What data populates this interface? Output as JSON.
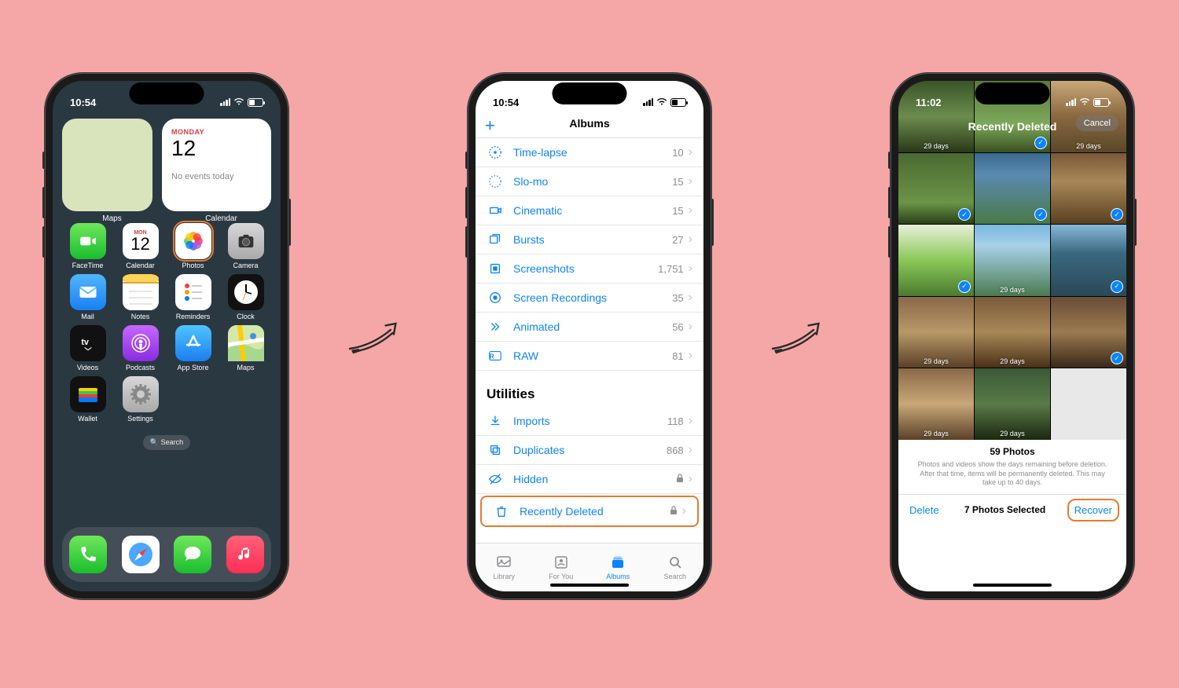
{
  "phone1": {
    "time": "10:54",
    "battery": "48",
    "widgets": {
      "maps_label": "Maps",
      "calendar_label": "Calendar",
      "cal_day": "MONDAY",
      "cal_date": "12",
      "cal_events": "No events today"
    },
    "apps": [
      {
        "label": "FaceTime",
        "icon": "facetime"
      },
      {
        "label": "Calendar",
        "icon": "calendar",
        "sub_top": "MON",
        "sub_main": "12"
      },
      {
        "label": "Photos",
        "icon": "photos",
        "highlight": true
      },
      {
        "label": "Camera",
        "icon": "camera"
      },
      {
        "label": "Mail",
        "icon": "mail"
      },
      {
        "label": "Notes",
        "icon": "notes"
      },
      {
        "label": "Reminders",
        "icon": "reminders"
      },
      {
        "label": "Clock",
        "icon": "clock"
      },
      {
        "label": "Videos",
        "icon": "videos"
      },
      {
        "label": "Podcasts",
        "icon": "podcasts"
      },
      {
        "label": "App Store",
        "icon": "appstore"
      },
      {
        "label": "Maps",
        "icon": "maps"
      },
      {
        "label": "Wallet",
        "icon": "wallet"
      },
      {
        "label": "Settings",
        "icon": "settings"
      }
    ],
    "search": "Search",
    "dock": [
      "phone",
      "safari",
      "messages",
      "music"
    ]
  },
  "phone2": {
    "time": "10:54",
    "battery": "48",
    "header_title": "Albums",
    "media_types": [
      {
        "label": "Time-lapse",
        "count": "10",
        "icon": "timelapse"
      },
      {
        "label": "Slo-mo",
        "count": "15",
        "icon": "slomo"
      },
      {
        "label": "Cinematic",
        "count": "15",
        "icon": "cinematic"
      },
      {
        "label": "Bursts",
        "count": "27",
        "icon": "bursts"
      },
      {
        "label": "Screenshots",
        "count": "1,751",
        "icon": "screenshots"
      },
      {
        "label": "Screen Recordings",
        "count": "35",
        "icon": "screenrec"
      },
      {
        "label": "Animated",
        "count": "56",
        "icon": "animated"
      },
      {
        "label": "RAW",
        "count": "81",
        "icon": "raw"
      }
    ],
    "utilities_header": "Utilities",
    "utilities": [
      {
        "label": "Imports",
        "count": "118",
        "icon": "imports"
      },
      {
        "label": "Duplicates",
        "count": "868",
        "icon": "duplicates"
      },
      {
        "label": "Hidden",
        "lock": true,
        "icon": "hidden"
      },
      {
        "label": "Recently Deleted",
        "lock": true,
        "icon": "trash",
        "highlight": true
      }
    ],
    "tabs": [
      {
        "label": "Library"
      },
      {
        "label": "For You"
      },
      {
        "label": "Albums",
        "active": true
      },
      {
        "label": "Search"
      }
    ]
  },
  "phone3": {
    "time": "11:02",
    "battery": "47",
    "title": "Recently Deleted",
    "cancel": "Cancel",
    "thumbs": [
      {
        "days": "29 days",
        "sel": false,
        "cls": "t1"
      },
      {
        "days": "",
        "sel": true,
        "cls": "t2"
      },
      {
        "days": "29 days",
        "sel": false,
        "cls": "t3"
      },
      {
        "days": "",
        "sel": true,
        "cls": "t4"
      },
      {
        "days": "",
        "sel": true,
        "cls": "t5"
      },
      {
        "days": "",
        "sel": true,
        "cls": "t6"
      },
      {
        "days": "",
        "sel": true,
        "cls": "t7"
      },
      {
        "days": "29 days",
        "sel": false,
        "cls": "t8"
      },
      {
        "days": "",
        "sel": true,
        "cls": "t9"
      },
      {
        "days": "29 days",
        "sel": false,
        "cls": "t10"
      },
      {
        "days": "29 days",
        "sel": false,
        "cls": "t11"
      },
      {
        "days": "",
        "sel": true,
        "cls": "t12"
      },
      {
        "days": "29 days",
        "sel": false,
        "cls": "t13"
      },
      {
        "days": "29 days",
        "sel": false,
        "cls": "t14"
      },
      {
        "days": "",
        "sel": false,
        "cls": "t15"
      }
    ],
    "footer": {
      "count": "59 Photos",
      "note": "Photos and videos show the days remaining before deletion. After that time, items will be permanently deleted. This may take up to 40 days.",
      "delete": "Delete",
      "selected": "7 Photos Selected",
      "recover": "Recover"
    }
  }
}
